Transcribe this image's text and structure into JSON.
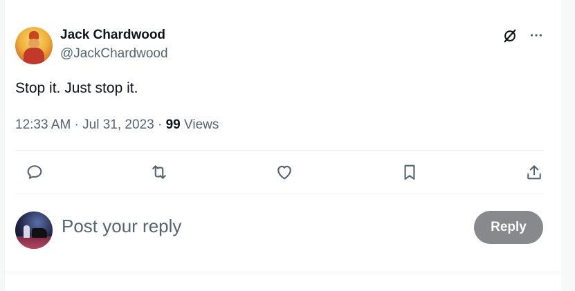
{
  "tweet": {
    "author_name": "Jack Chardwood",
    "author_handle": "@JackChardwood",
    "text": "Stop it. Just stop it.",
    "time": "12:33 AM",
    "separator_1": " · ",
    "date": "Jul 31, 2023",
    "separator_2": " · ",
    "view_count": "99",
    "views_label": " Views"
  },
  "header_icons": [
    "grok-icon",
    "more-icon"
  ],
  "actions": [
    "reply-icon",
    "retweet-icon",
    "like-icon",
    "bookmark-icon",
    "share-icon"
  ],
  "reply_box": {
    "placeholder": "Post your reply",
    "button_label": "Reply"
  },
  "colors": {
    "text_primary": "#0f1419",
    "text_secondary": "#536471",
    "reply_button_bg": "#87898c",
    "divider": "#eff3f4"
  }
}
